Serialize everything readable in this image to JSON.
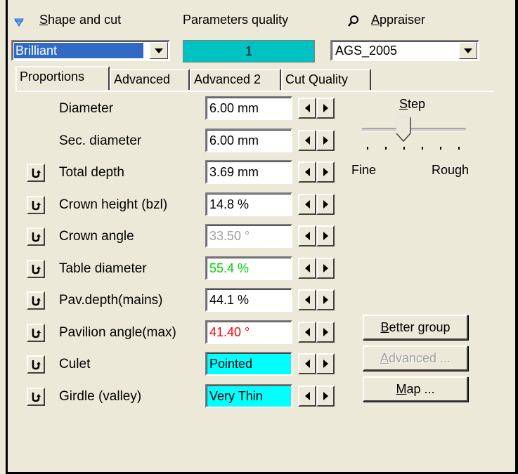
{
  "header": {
    "shape_label": "Shape and cut",
    "shape_underline": "S",
    "shape_rest": "hape and cut",
    "quality_label": "Parameters quality",
    "appraiser_underline": "A",
    "appraiser_rest": "ppraiser",
    "shape_value": "Brilliant",
    "quality_value": "1",
    "appraiser_value": "AGS_2005"
  },
  "tabs": [
    "Proportions",
    "Advanced",
    "Advanced 2",
    "Cut Quality"
  ],
  "rows": [
    {
      "label": "Diameter",
      "value": "6.00 mm",
      "color": "#000000",
      "cyan": false,
      "icon": false
    },
    {
      "label": "Sec. diameter",
      "value": "6.00 mm",
      "color": "#000000",
      "cyan": false,
      "icon": false
    },
    {
      "label": "Total depth",
      "value": "3.69 mm",
      "color": "#000000",
      "cyan": false,
      "icon": true
    },
    {
      "label": "Crown height (bzl)",
      "value": "14.8 %",
      "color": "#000000",
      "cyan": false,
      "icon": true
    },
    {
      "label": "Crown angle",
      "value": "33.50 °",
      "color": "#a0a0a0",
      "cyan": false,
      "icon": true
    },
    {
      "label": "Table diameter",
      "value": "55.4 %",
      "color": "#00d000",
      "cyan": false,
      "icon": true
    },
    {
      "label": "Pav.depth(mains)",
      "value": "44.1 %",
      "color": "#000000",
      "cyan": false,
      "icon": true
    },
    {
      "label": "Pavilion angle(max)",
      "value": "41.40 °",
      "color": "#ff0000",
      "cyan": false,
      "icon": true
    },
    {
      "label": "Culet",
      "value": "Pointed",
      "color": "#000000",
      "cyan": true,
      "icon": true
    },
    {
      "label": "Girdle (valley)",
      "value": "Very Thin",
      "color": "#000000",
      "cyan": true,
      "icon": true
    }
  ],
  "step": {
    "title_underline": "S",
    "title_rest": "tep",
    "fine": "Fine",
    "rough": "Rough",
    "position": 0.4
  },
  "buttons": {
    "better_group_u": "B",
    "better_group_rest": "etter group",
    "advanced_u": "A",
    "advanced_rest": "dvanced ...",
    "map_u": "M",
    "map_rest": "ap ..."
  },
  "colors": {
    "quality_bg": "#00c2c2",
    "cyan_field": "#00ffff",
    "selection": "#316ac5"
  }
}
